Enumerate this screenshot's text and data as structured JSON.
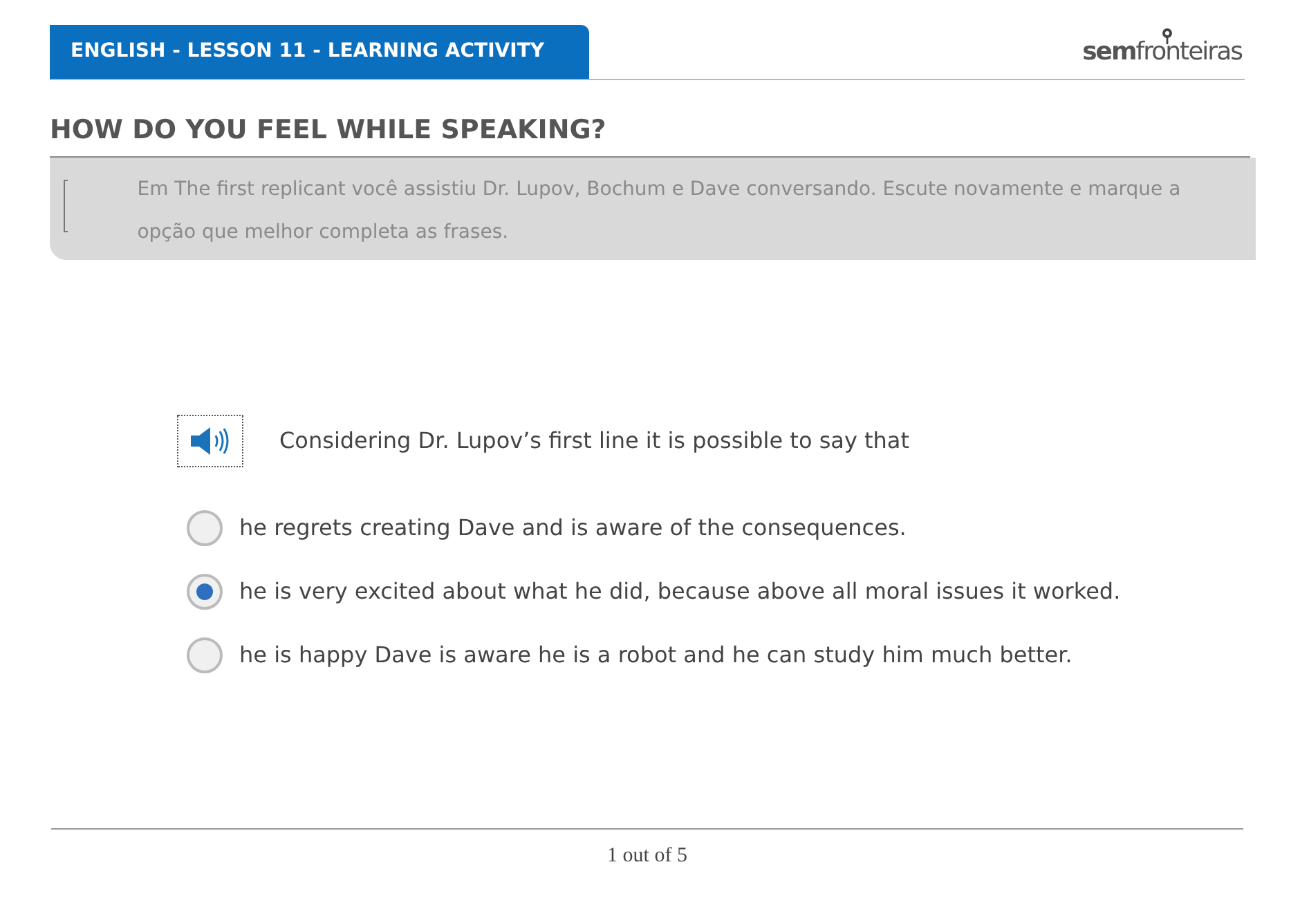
{
  "header": {
    "title": "ENGLISH - LESSON 11 - LEARNING ACTIVITY",
    "logo_left": "sem",
    "logo_right": "fronteiras"
  },
  "heading": "HOW DO YOU FEEL WHILE SPEAKING?",
  "instruction": "Em The first replicant você assistiu Dr. Lupov, Bochum e Dave conversando. Escute novamente e marque a opção que melhor completa as frases.",
  "question": "Considering Dr. Lupov’s first line it is possible to say that",
  "options": [
    {
      "label": "he regrets creating Dave and is aware of the consequences.",
      "selected": false
    },
    {
      "label": "he is very excited about what he did, because above all moral issues it worked.",
      "selected": true
    },
    {
      "label": "he is happy Dave is aware he is a robot and he can study him much better.",
      "selected": false
    }
  ],
  "pager": "1 out of 5"
}
